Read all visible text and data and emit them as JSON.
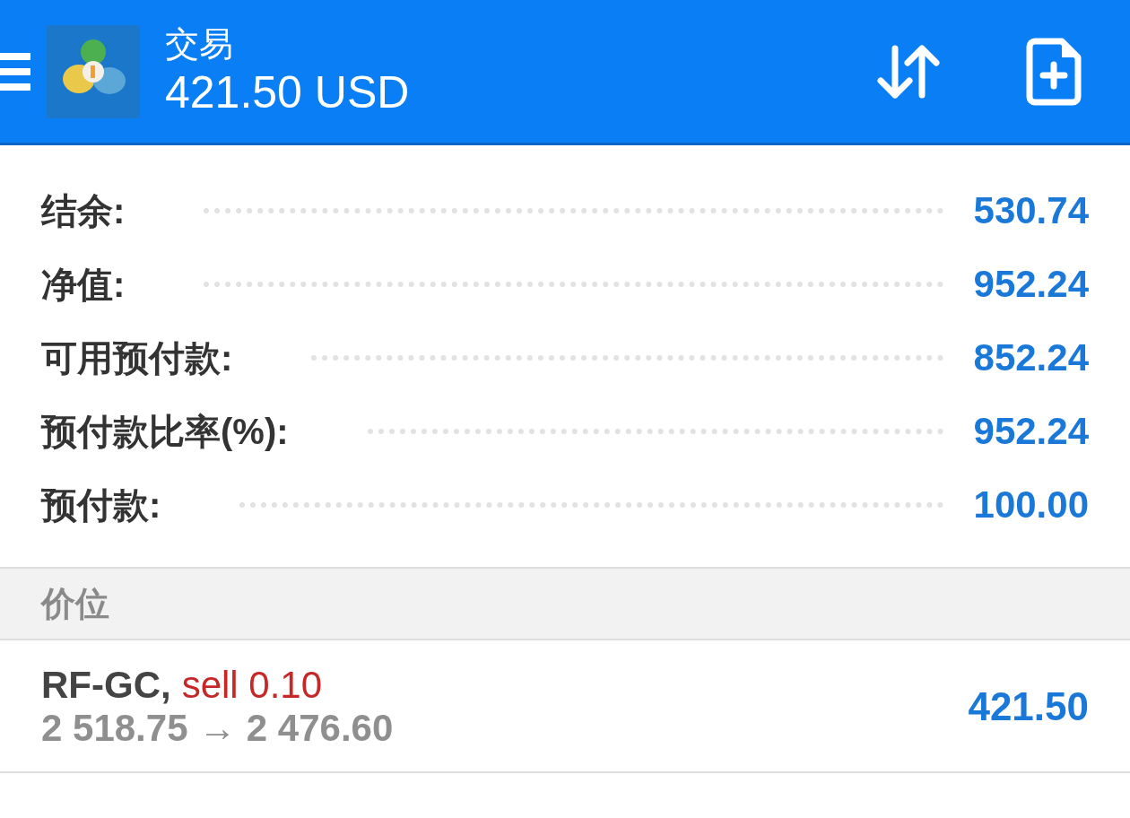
{
  "header": {
    "title": "交易",
    "balance": "421.50 USD"
  },
  "summary": [
    {
      "label": "结余:",
      "value": "530.74"
    },
    {
      "label": "净值:",
      "value": "952.24"
    },
    {
      "label": "可用预付款:",
      "value": "852.24"
    },
    {
      "label": "预付款比率(%):",
      "value": "952.24"
    },
    {
      "label": "预付款:",
      "value": "100.00"
    }
  ],
  "section": {
    "title": "价位"
  },
  "positions": [
    {
      "symbol": "RF-GC,",
      "order": "sell 0.10",
      "prices": "2 518.75 → 2 476.60",
      "profit": "421.50"
    }
  ]
}
